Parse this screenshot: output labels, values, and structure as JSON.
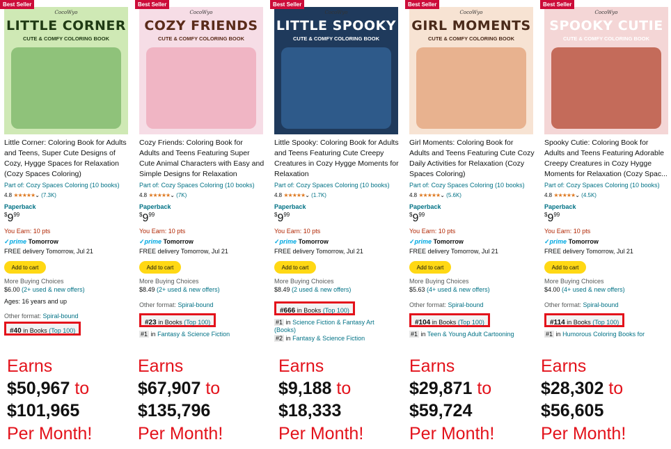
{
  "products": [
    {
      "badge": "Best Seller",
      "cover": {
        "brand": "CocoWyo",
        "title": "LITTLE CORNER",
        "subtitle": "CUTE & COMFY COLORING BOOK",
        "bg": "#cfe9b5",
        "art": "#8fc27a",
        "title_color": "#1f3a14"
      },
      "title": "Little Corner: Coloring Book for Adults and Teens, Super Cute Designs of Cozy, Hygge Spaces for Relaxation (Cozy Spaces Coloring)",
      "series": "Part of: Cozy Spaces Coloring (10 books)",
      "rating": "4.8",
      "stars": "★★★★★",
      "review_count": "(7.3K)",
      "format": "Paperback",
      "price_currency": "$",
      "price_whole": "9",
      "price_cents": "99",
      "you_earn": "You Earn: 10 pts",
      "prime_label": "prime",
      "prime_day": "Tomorrow",
      "delivery": "FREE delivery Tomorrow, Jul 21",
      "add_to_cart": "Add to cart",
      "more_buying": "More Buying Choices",
      "offer_price": "$6.00",
      "offer_link": "(2+ used & new offers)",
      "ages": "Ages: 16 years and up",
      "other_format_label": "Other format:",
      "other_format": "Spiral-bound",
      "rank": "#40",
      "rank_in": "in Books",
      "rank_top": "(Top 100)",
      "sub_rank_num": "",
      "sub_rank_in": "",
      "sub_rank_cat": "",
      "earnings_label": "Earns",
      "earnings_low": "$50,967",
      "earnings_to": "to",
      "earnings_high": "$101,965",
      "earnings_period": "Per Month!"
    },
    {
      "badge": "Best Seller",
      "cover": {
        "brand": "CocoWyo",
        "title": "COZY FRIENDS",
        "subtitle": "CUTE & COMFY COLORING BOOK",
        "bg": "#f6dde6",
        "art": "#f0b5c4",
        "title_color": "#5a2b1a"
      },
      "title": "Cozy Friends: Coloring Book for Adults and Teens Featuring Super Cute Animal Characters with Easy and Simple Designs for Relaxation",
      "series": "Part of: Cozy Spaces Coloring (10 books)",
      "rating": "4.8",
      "stars": "★★★★★",
      "review_count": "(7K)",
      "format": "Paperback",
      "price_currency": "$",
      "price_whole": "9",
      "price_cents": "99",
      "you_earn": "You Earn: 10 pts",
      "prime_label": "prime",
      "prime_day": "Tomorrow",
      "delivery": "FREE delivery Tomorrow, Jul 21",
      "add_to_cart": "Add to cart",
      "more_buying": "More Buying Choices",
      "offer_price": "$8.49",
      "offer_link": "(2+ used & new offers)",
      "ages": "",
      "other_format_label": "Other format:",
      "other_format": "Spiral-bound",
      "rank": "#23",
      "rank_in": "in Books",
      "rank_top": "(Top 100)",
      "sub_rank_num": "#1",
      "sub_rank_in": "in",
      "sub_rank_cat": "Fantasy & Science Fiction",
      "earnings_label": "Earns",
      "earnings_low": "$67,907",
      "earnings_to": "to",
      "earnings_high": "$135,796",
      "earnings_period": "Per Month!"
    },
    {
      "badge": "Best Seller",
      "cover": {
        "brand": "CocoWyo",
        "title": "LITTLE SPOOKY",
        "subtitle": "CUTE & COMFY COLORING BOOK",
        "bg": "#1f3a5c",
        "art": "#2e5a8a",
        "title_color": "#ffffff"
      },
      "title": "Little Spooky: Coloring Book for Adults and Teens Featuring Cute Creepy Creatures in Cozy Hygge Moments for Relaxation",
      "series": "Part of: Cozy Spaces Coloring (10 books)",
      "rating": "4.8",
      "stars": "★★★★★",
      "review_count": "(1.7K)",
      "format": "Paperback",
      "price_currency": "$",
      "price_whole": "9",
      "price_cents": "99",
      "you_earn": "You Earn: 10 pts",
      "prime_label": "prime",
      "prime_day": "Tomorrow",
      "delivery": "FREE delivery Tomorrow, Jul 21",
      "add_to_cart": "Add to cart",
      "more_buying": "More Buying Choices",
      "offer_price": "$8.49",
      "offer_link": "(2 used & new offers)",
      "ages": "",
      "other_format_label": "",
      "other_format": "",
      "rank": "#666",
      "rank_in": "in Books",
      "rank_top": "(Top 100)",
      "sub_rank_num": "#1",
      "sub_rank_in": "in",
      "sub_rank_cat": "Science Fiction & Fantasy Art",
      "sub_rank_extra": "(Books)",
      "sub_rank2_num": "#2",
      "sub_rank2_cat": "Fantasy & Science Fiction",
      "earnings_label": "Earns",
      "earnings_low": "$9,188",
      "earnings_to": "to",
      "earnings_high": "$18,333",
      "earnings_period": "Per Month!"
    },
    {
      "badge": "Best Seller",
      "cover": {
        "brand": "CocoWyo",
        "title": "GIRL MOMENTS",
        "subtitle": "CUTE & COMFY COLORING BOOK",
        "bg": "#f7e3d3",
        "art": "#e8b28f",
        "title_color": "#4a2a1a"
      },
      "title": "Girl Moments: Coloring Book for Adults and Teens Featuring Cute Cozy Daily Activities for Relaxation (Cozy Spaces Coloring)",
      "series": "Part of: Cozy Spaces Coloring (10 books)",
      "rating": "4.8",
      "stars": "★★★★★",
      "review_count": "(5.6K)",
      "format": "Paperback",
      "price_currency": "$",
      "price_whole": "9",
      "price_cents": "99",
      "you_earn": "You Earn: 10 pts",
      "prime_label": "prime",
      "prime_day": "Tomorrow",
      "delivery": "FREE delivery Tomorrow, Jul 21",
      "add_to_cart": "Add to cart",
      "more_buying": "More Buying Choices",
      "offer_price": "$5.63",
      "offer_link": "(4+ used & new offers)",
      "ages": "",
      "other_format_label": "Other format:",
      "other_format": "Spiral-bound",
      "rank": "#104",
      "rank_in": "in Books",
      "rank_top": "(Top 100)",
      "sub_rank_num": "#1",
      "sub_rank_in": "in",
      "sub_rank_cat": "Teen & Young Adult Cartooning",
      "earnings_label": "Earns",
      "earnings_low": "$29,871",
      "earnings_to": "to",
      "earnings_high": "$59,724",
      "earnings_period": "Per Month!"
    },
    {
      "badge": "Best Seller",
      "cover": {
        "brand": "CocoWyo",
        "title": "SPOOKY CUTIE",
        "subtitle": "CUTE & COMFY COLORING BOOK",
        "bg": "#f4d6d6",
        "art": "#c46b5a",
        "title_color": "#ffffff"
      },
      "title": "Spooky Cutie: Coloring Book for Adults and Teens Featuring Adorable Creepy Creatures in Cozy Hygge Moments for Relaxation (Cozy Spac...",
      "series": "Part of: Cozy Spaces Coloring (10 books)",
      "rating": "4.8",
      "stars": "★★★★★",
      "review_count": "(4.5K)",
      "format": "Paperback",
      "price_currency": "$",
      "price_whole": "9",
      "price_cents": "99",
      "you_earn": "You Earn: 10 pts",
      "prime_label": "prime",
      "prime_day": "Tomorrow",
      "delivery": "FREE delivery Tomorrow, Jul 21",
      "add_to_cart": "Add to cart",
      "more_buying": "More Buying Choices",
      "offer_price": "$4.00",
      "offer_link": "(4+ used & new offers)",
      "ages": "",
      "other_format_label": "Other format:",
      "other_format": "Spiral-bound",
      "rank": "#114",
      "rank_in": "in Books",
      "rank_top": "(Top 100)",
      "sub_rank_num": "#1",
      "sub_rank_in": "in",
      "sub_rank_cat": "Humorous Coloring Books for",
      "earnings_label": "Earns",
      "earnings_low": "$28,302",
      "earnings_to": "to",
      "earnings_high": "$56,605",
      "earnings_period": "Per Month!"
    }
  ],
  "colors": {
    "badge": "#cc0c39",
    "link": "#007185",
    "highlight_box": "#e3121b",
    "add_to_cart": "#ffd814",
    "earnings_red": "#e3121b"
  }
}
